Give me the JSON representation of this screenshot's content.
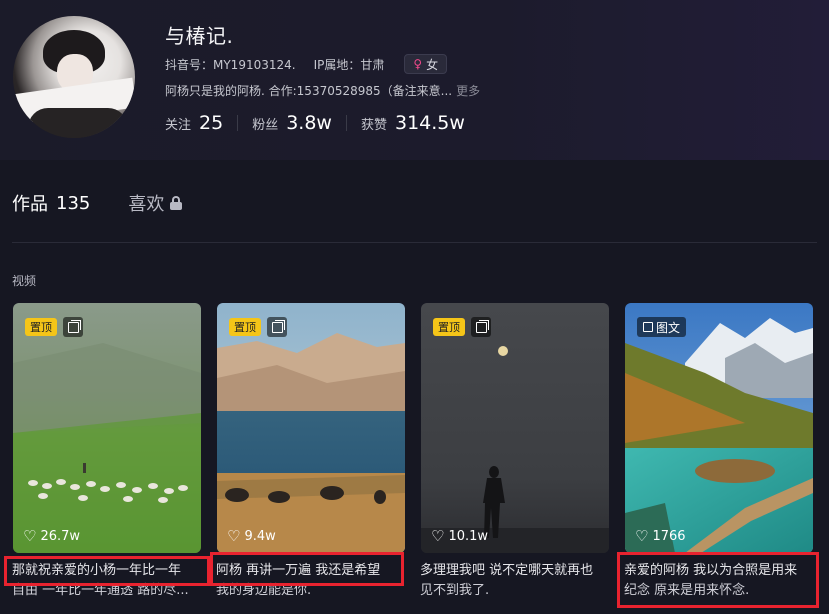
{
  "profile": {
    "name": "与椿记.",
    "douyin_id": "抖音号：MY19103124.",
    "ip": "IP属地：甘肃",
    "gender": "女",
    "gender_symbol": "♀",
    "signature": "阿杨只是我的阿杨. 合作:15370528985（备注来意...",
    "more": "更多",
    "stats": [
      {
        "label": "关注",
        "value": "25"
      },
      {
        "label": "粉丝",
        "value": "3.8w"
      },
      {
        "label": "获赞",
        "value": "314.5w"
      }
    ]
  },
  "tabs": {
    "works_label": "作品",
    "works_count": "135",
    "likes_label": "喜欢"
  },
  "section_label": "视频",
  "cards": [
    {
      "pinned": "置顶",
      "likes": "26.7w",
      "caption_line1": "那就祝亲爱的小杨一年比一年",
      "caption_line2": "自由 一年比一年通透 路的尽..."
    },
    {
      "pinned": "置顶",
      "likes": "9.4w",
      "caption_line1": "阿杨 再讲一万遍 我还是希望",
      "caption_line2": "我的身边能是你."
    },
    {
      "pinned": "置顶",
      "likes": "10.1w",
      "caption_line1": "多理理我吧 说不定哪天就再也",
      "caption_line2": "见不到我了."
    },
    {
      "photo_label": "图文",
      "likes": "1766",
      "caption_line1": "亲爱的阿杨 我以为合照是用来",
      "caption_line2": "纪念 原来是用来怀念."
    }
  ],
  "icons": {
    "heart": "♡"
  },
  "colors": {
    "background": "#161722",
    "pin_badge": "#f5c518",
    "highlight_box": "#e8232f",
    "female_symbol": "#f0488a"
  }
}
